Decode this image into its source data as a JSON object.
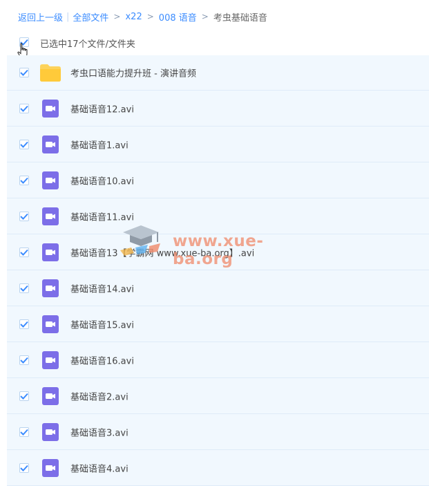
{
  "breadcrumb": {
    "back": "返回上一级",
    "all_files": "全部文件",
    "path": [
      "x22",
      "008 语音"
    ],
    "current": "考虫基础语音"
  },
  "selection": {
    "label": "已选中17个文件/文件夹",
    "checked": true
  },
  "files": [
    {
      "name": "考虫口语能力提升班 - 演讲音频",
      "type": "folder",
      "checked": true
    },
    {
      "name": "基础语音12.avi",
      "type": "video",
      "checked": true
    },
    {
      "name": "基础语音1.avi",
      "type": "video",
      "checked": true
    },
    {
      "name": "基础语音10.avi",
      "type": "video",
      "checked": true
    },
    {
      "name": "基础语音11.avi",
      "type": "video",
      "checked": true
    },
    {
      "name": "基础语音13【学霸网 www.xue-ba.org】.avi",
      "type": "video",
      "checked": true
    },
    {
      "name": "基础语音14.avi",
      "type": "video",
      "checked": true
    },
    {
      "name": "基础语音15.avi",
      "type": "video",
      "checked": true
    },
    {
      "name": "基础语音16.avi",
      "type": "video",
      "checked": true
    },
    {
      "name": "基础语音2.avi",
      "type": "video",
      "checked": true
    },
    {
      "name": "基础语音3.avi",
      "type": "video",
      "checked": true
    },
    {
      "name": "基础语音4.avi",
      "type": "video",
      "checked": true
    }
  ],
  "watermark": {
    "text": "www.xue-ba.org"
  },
  "colors": {
    "link": "#3b8cff",
    "row_bg": "#f1f8fe",
    "checkbox": "#3b8cff",
    "video_icon": "#7c6ee8",
    "folder_icon": "#fdd35b"
  }
}
